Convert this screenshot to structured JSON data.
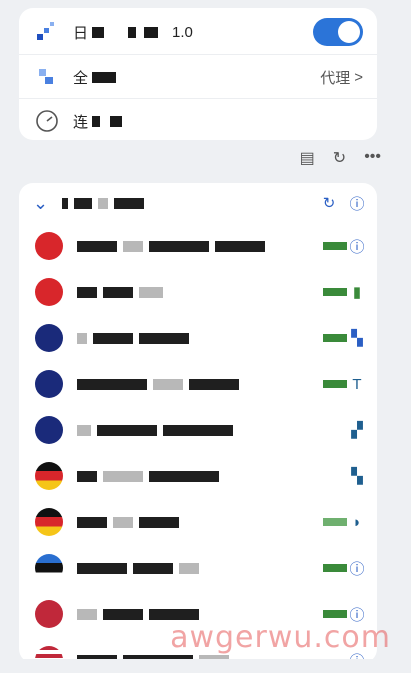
{
  "settings": {
    "row1": {
      "label": "日",
      "version": "1.0",
      "toggle_on": true
    },
    "row2": {
      "label": "全",
      "right_label": "代理",
      "chevron": ">"
    },
    "row3": {
      "label": "连"
    }
  },
  "toolbar": {
    "icons": [
      "clipboard-icon",
      "refresh-icon",
      "more-icon"
    ]
  },
  "watermark": "awgerwu.com",
  "nodes": [
    {
      "flag": "hong-kong"
    },
    {
      "flag": "hong-kong"
    },
    {
      "flag": "australia"
    },
    {
      "flag": "australia"
    },
    {
      "flag": "australia"
    },
    {
      "flag": "germany"
    },
    {
      "flag": "germany"
    },
    {
      "flag": "estonia"
    },
    {
      "flag": "usa-like"
    },
    {
      "flag": "usa"
    }
  ],
  "colors": {
    "accent": "#2b74d8",
    "link": "#2b5fc4",
    "metric": "#3a8a3a"
  }
}
